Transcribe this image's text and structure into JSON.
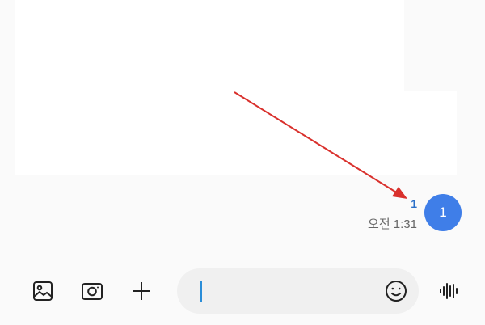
{
  "message": {
    "bubble_text": "1",
    "unread_count": "1",
    "time": "오전 1:31"
  },
  "composer": {
    "input_value": "",
    "icons": {
      "gallery": "image-icon",
      "camera": "camera-icon",
      "more": "plus-icon",
      "emoji": "emoji-icon",
      "voice": "voice-icon"
    }
  },
  "colors": {
    "bubble": "#3f7ee8",
    "unread": "#2a6fc8",
    "arrow": "#d9302c",
    "caret": "#2a8dd8"
  }
}
